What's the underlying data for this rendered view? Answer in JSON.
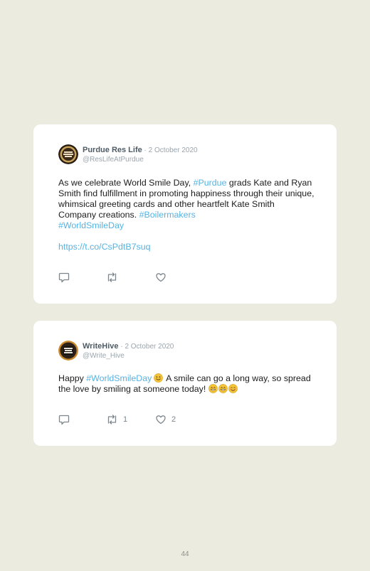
{
  "tweets": [
    {
      "author": "Purdue Res Life",
      "separator": " · ",
      "date": "2 October 2020",
      "handle": "@ResLifeAtPurdue",
      "text_parts": [
        "As we celebrate World Smile Day, ",
        "#Purdue",
        " grads Kate and Ryan Smith find fulfillment in promoting happiness through their unique, whimsical greeting cards and other heartfelt Kate Smith Company creations. ",
        "#Boilermakers",
        "#WorldSmileDay"
      ],
      "link": "https://t.co/CsPdtB7suq",
      "retweets": "",
      "likes": ""
    },
    {
      "author": "WriteHive",
      "separator": " · ",
      "date": "2 October 2020",
      "handle": "@Write_Hive",
      "text_parts": [
        "Happy ",
        "#WorldSmileDay",
        " A smile can go a long way, so spread the love by smiling at someone today! "
      ],
      "retweets": "1",
      "likes": "2"
    }
  ],
  "icons": {
    "reply": "reply-icon",
    "retweet": "retweet-icon",
    "like": "heart-icon"
  },
  "colors": {
    "background": "#ebebdf",
    "card": "#ffffff",
    "hashtag": "#54b3e3",
    "icon": "#7d868c"
  },
  "page_number": "44"
}
